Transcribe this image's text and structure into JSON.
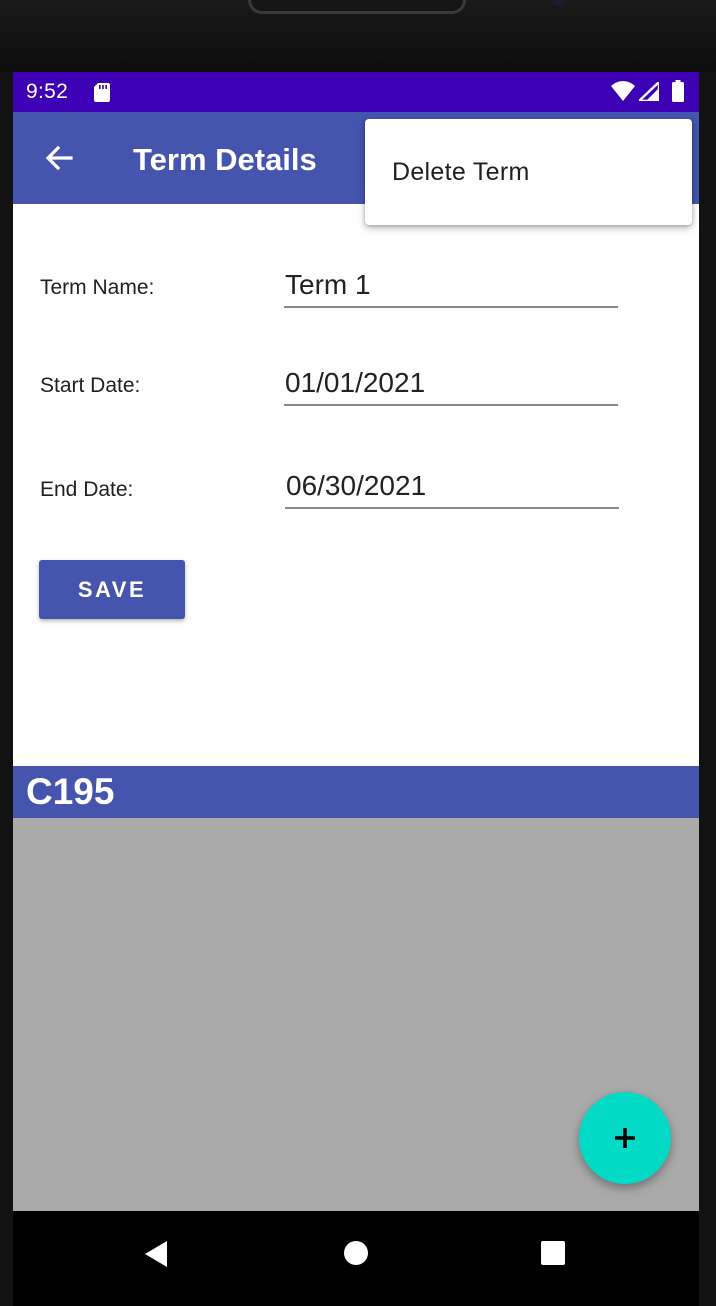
{
  "status_bar": {
    "time": "9:52",
    "icons": [
      "sd-card-icon",
      "wifi-icon",
      "cell-signal-icon",
      "battery-icon"
    ],
    "background": "#3d00b5"
  },
  "app_bar": {
    "title": "Term Details",
    "back_icon": "arrow-left-icon",
    "background": "#4555ae"
  },
  "overflow_menu": {
    "items": [
      {
        "label": "Delete Term"
      }
    ]
  },
  "form": {
    "term_name": {
      "label": "Term Name:",
      "value": "Term 1"
    },
    "start_date": {
      "label": "Start Date:",
      "value": "01/01/2021"
    },
    "end_date": {
      "label": "End Date:",
      "value": "06/30/2021"
    },
    "save_label": "SAVE"
  },
  "courses": {
    "items": [
      {
        "title": "C195"
      }
    ],
    "list_background": "#aaaaaa"
  },
  "fab": {
    "icon": "plus-icon",
    "color": "#03dac5"
  },
  "nav_bar": {
    "icons": [
      "nav-back-icon",
      "nav-home-icon",
      "nav-recents-icon"
    ]
  }
}
